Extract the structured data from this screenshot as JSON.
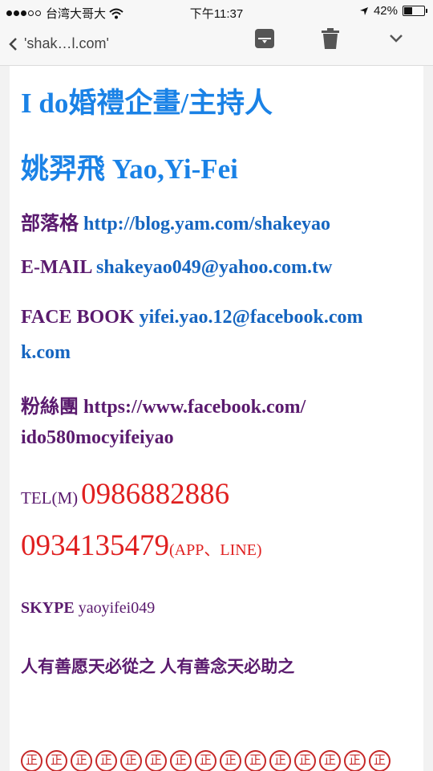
{
  "status_bar": {
    "carrier": "台湾大哥大",
    "time": "下午11:37",
    "battery": "42%",
    "battery_level": 0.42
  },
  "nav": {
    "back_label": "'shak…l.com'",
    "icons": [
      "chevron-left-icon",
      "archive-icon",
      "trash-icon",
      "chevron-down-icon"
    ]
  },
  "content": {
    "title": "I do婚禮企畫/主持人",
    "name": "姚羿飛 Yao,Yi-Fei",
    "blog_label": "部落格",
    "blog_url": "http://blog.yam.com/shakeyao",
    "email_label": "E-MAIL",
    "email_value": "shakeyao049@yahoo.com.tw",
    "facebook_label": "FACE BOOK",
    "facebook_value": "yifei.yao.12@facebook.com",
    "facebook_value_cont": "k.com",
    "fans_label": "粉絲團",
    "fans_url_1": "https://www.facebook.com/",
    "fans_url_2": "ido580mocyifeiyao",
    "tel_label": "TEL(M)",
    "tel_1": "0986882886",
    "tel_2": "0934135479",
    "tel_2_note": "(APP、LINE)",
    "skype_label": "SKYPE",
    "skype_value": "yaoyifei049",
    "motto": "人有善愿天必從之 人有善念天必助之",
    "circled_glyph": "正"
  },
  "colors": {
    "title_blue": "#1a82e6",
    "link_blue": "#1565c0",
    "label_purple": "#5a1a6e",
    "phone_red": "#e02020"
  }
}
